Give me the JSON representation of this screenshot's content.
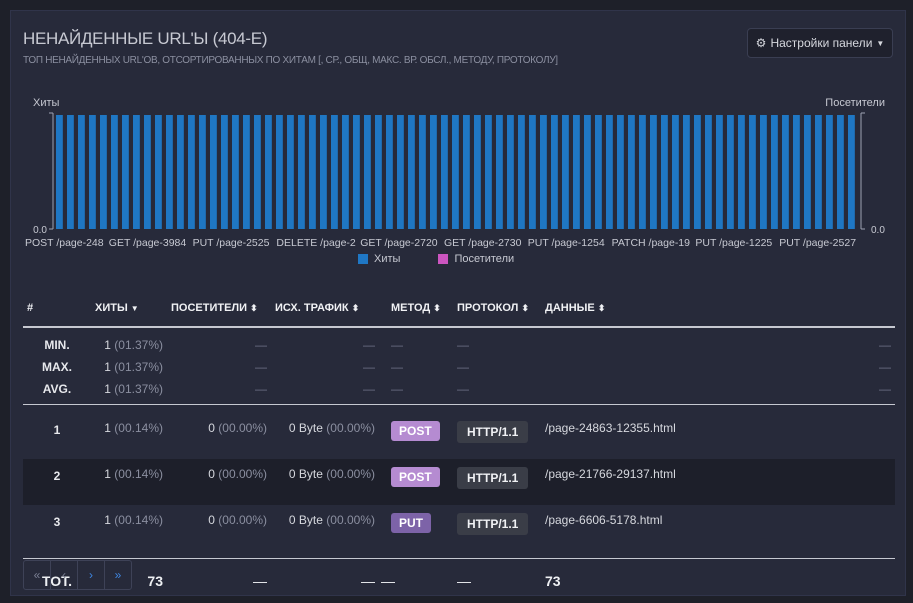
{
  "panel": {
    "title": "НЕНАЙДЕННЫЕ URL'Ы (404-Е)",
    "subtitle": "ТОП НЕНАЙДЕННЫХ URL'ОВ, ОТСОРТИРОВАННЫХ ПО ХИТАМ [, СР., ОБЩ, МАКС. ВР. ОБСЛ., МЕТОДУ, ПРОТОКОЛУ]",
    "settings_label": "Настройки панели"
  },
  "chart_data": {
    "type": "bar",
    "ylabel_left": "Хиты",
    "ylabel_right": "Посетители",
    "y_left_tick": "0.0",
    "y_right_tick": "0.0",
    "bar_count": 73,
    "x_tick_labels": [
      "POST /page-248",
      "GET /page-3984",
      "PUT /page-2525",
      "DELETE /page-2",
      "GET /page-2720",
      "GET /page-2730",
      "PUT /page-1254",
      "PATCH /page-19",
      "PUT /page-1225",
      "PUT /page-2527"
    ],
    "series": [
      {
        "name": "Хиты",
        "color": "#1f77c4"
      },
      {
        "name": "Посетители",
        "color": "#cc55c0"
      }
    ]
  },
  "table": {
    "headers": {
      "num": "#",
      "hits": "ХИТЫ",
      "visitors": "ПОСЕТИТЕЛИ",
      "bandwidth": "ИСХ. ТРАФИК",
      "method": "МЕТОД",
      "protocol": "ПРОТОКОЛ",
      "data": "ДАННЫЕ"
    },
    "stats": {
      "min": {
        "label": "MIN.",
        "hits": "1",
        "hits_pct": "(01.37%)"
      },
      "max": {
        "label": "MAX.",
        "hits": "1",
        "hits_pct": "(01.37%)"
      },
      "avg": {
        "label": "AVG.",
        "hits": "1",
        "hits_pct": "(01.37%)"
      },
      "dash": "—"
    },
    "rows": [
      {
        "num": "1",
        "hits": "1",
        "hits_pct": "(00.14%)",
        "visitors": "0",
        "visitors_pct": "(00.00%)",
        "bw": "0 Byte",
        "bw_pct": "(00.00%)",
        "method": "POST",
        "protocol": "HTTP/1.1",
        "data": "/page-24863-12355.html"
      },
      {
        "num": "2",
        "hits": "1",
        "hits_pct": "(00.14%)",
        "visitors": "0",
        "visitors_pct": "(00.00%)",
        "bw": "0 Byte",
        "bw_pct": "(00.00%)",
        "method": "POST",
        "protocol": "HTTP/1.1",
        "data": "/page-21766-29137.html"
      },
      {
        "num": "3",
        "hits": "1",
        "hits_pct": "(00.14%)",
        "visitors": "0",
        "visitors_pct": "(00.00%)",
        "bw": "0 Byte",
        "bw_pct": "(00.00%)",
        "method": "PUT",
        "protocol": "HTTP/1.1",
        "data": "/page-6606-5178.html"
      }
    ],
    "total": {
      "label": "TOT.",
      "hits": "73",
      "visitors": "—",
      "bw": "—",
      "method": "—",
      "protocol": "—",
      "data": "73"
    }
  },
  "pager": {
    "first": "«",
    "prev": "‹",
    "next": "›",
    "last": "»"
  }
}
